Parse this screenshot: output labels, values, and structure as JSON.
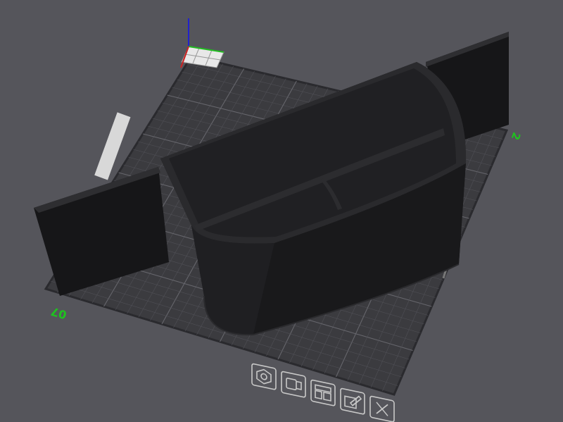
{
  "viewport": {
    "background": "#55555b",
    "plate_label_front": "07",
    "plate_label_right": "2"
  },
  "colors": {
    "bed": "#3b3b3f",
    "bed_edge": "#2a2a2e",
    "grid_minor": "#505056",
    "grid_major": "#66666c",
    "model": "#1c1c1e",
    "label_green": "#1ec31e",
    "axis_x": "#cc2222",
    "axis_y": "#22bb22",
    "axis_z": "#2222cc"
  },
  "model": {
    "name": "divided-container-with-wings"
  },
  "plate_toolbar": {
    "icons": [
      {
        "name": "orient-icon"
      },
      {
        "name": "arrange-icon"
      },
      {
        "name": "layout-icon"
      },
      {
        "name": "edit-plate-icon"
      },
      {
        "name": "delete-plate-icon"
      }
    ]
  }
}
